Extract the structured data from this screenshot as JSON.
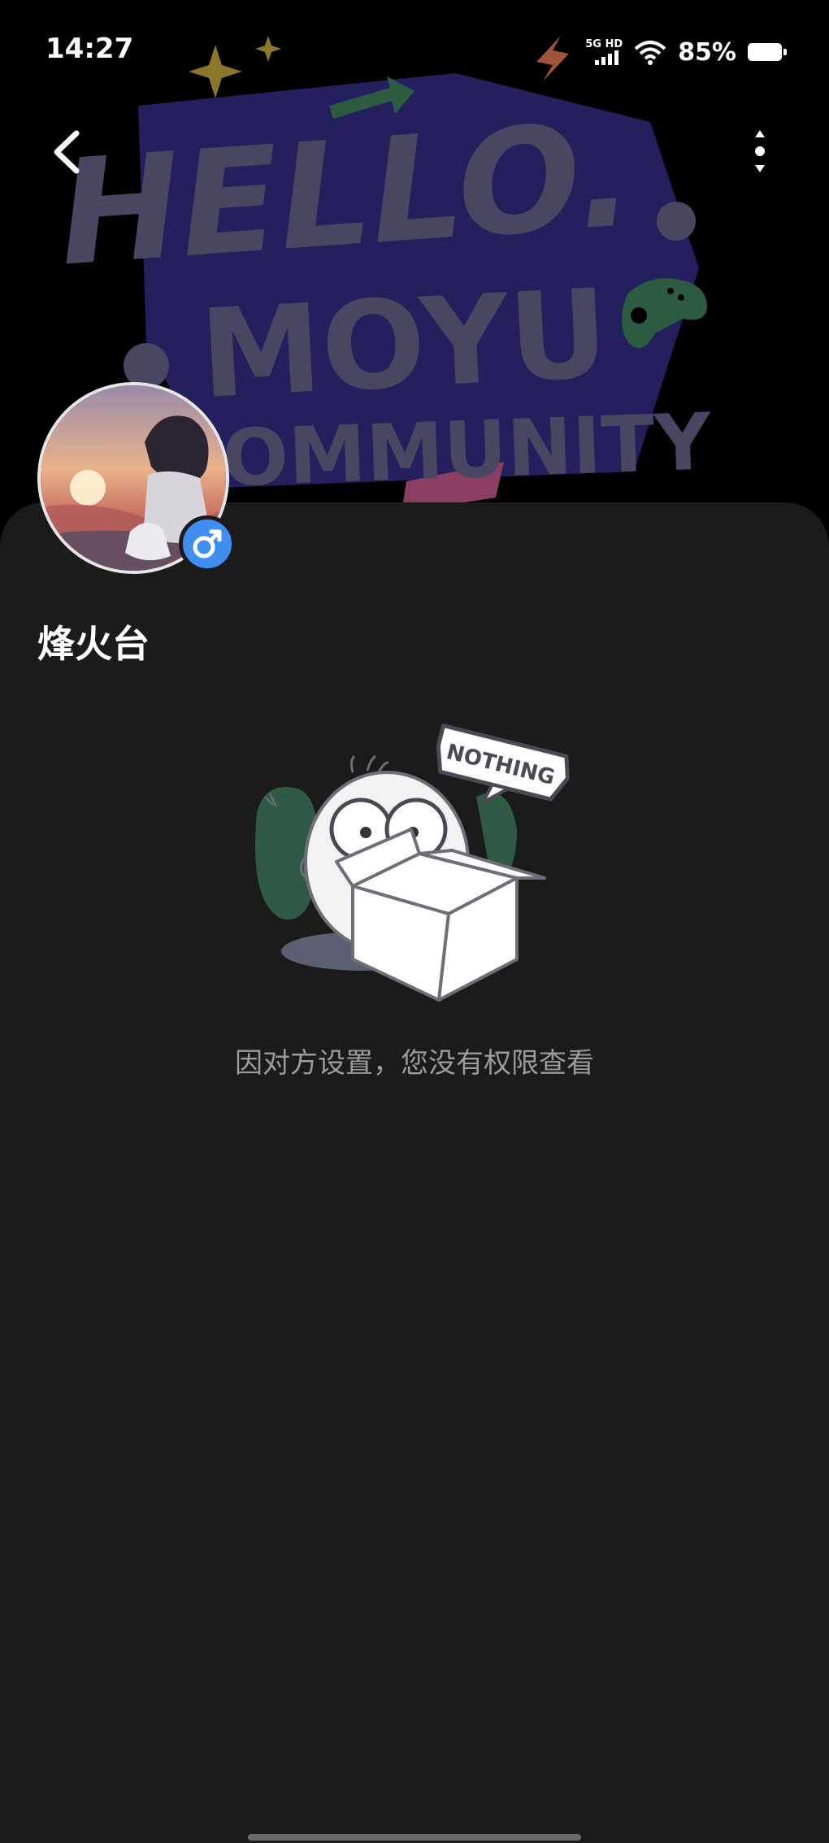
{
  "status_bar": {
    "time": "14:27",
    "network_label": "5G HD",
    "battery_percent": "85%",
    "icons": [
      "signal-icon",
      "wifi-icon",
      "battery-icon"
    ]
  },
  "banner": {
    "line1": "HELLO.",
    "line2": "MOYU",
    "line3": "COMMUNITY"
  },
  "nav": {
    "back_icon": "chevron-left-icon",
    "more_icon": "more-vertical-icon"
  },
  "profile": {
    "name": "烽火台",
    "gender_icon": "male-icon",
    "badge_color": "#3f8ef0"
  },
  "empty_state": {
    "badge_text": "NOTHING",
    "message": "因对方设置，您没有权限查看"
  },
  "colors": {
    "background": "#000000",
    "card": "#1b1b1b",
    "banner_text": "#494661",
    "banner_shape": "#24205e",
    "message_text": "#9b9b9b"
  }
}
